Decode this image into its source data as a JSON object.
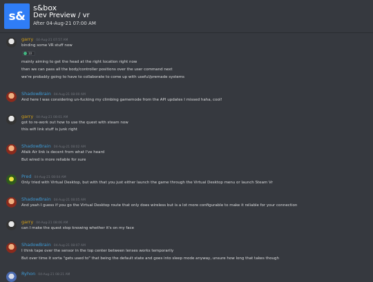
{
  "header": {
    "logo_text": "s&",
    "server_name": "s&box",
    "channel": "Dev Preview / vr",
    "date_filter": "After 04-Aug-21 07:00 AM"
  },
  "colors": {
    "garry": "#d4a017",
    "ShadowBrain": "#3e9bd6",
    "Pred": "#3e9bd6",
    "Ryhon": "#3e9bd6"
  },
  "messages": [
    {
      "author": "garry",
      "timestamp": "04-Aug-21 07:57 AM",
      "avatar": "garry-avatar",
      "lines": [
        "binding some VR stuff now"
      ],
      "reaction": {
        "emoji": "green-emoji-icon",
        "count": "10"
      },
      "extra_lines": [
        "mainly aiming to get the head at the right location right now",
        "then we can pass all the body/controller positions over the user command next",
        "we're probably going to have to collaborate to come up with useful/premade systems"
      ]
    },
    {
      "author": "ShadowBrain",
      "timestamp": "04-Aug-21 08:00 AM",
      "avatar": "shadowbrain-avatar",
      "lines": [
        "And here I was considering un-fucking my climbing gamemode from the API updates I missed haha, cool!"
      ]
    },
    {
      "author": "garry",
      "timestamp": "04-Aug-21 08:01 AM",
      "avatar": "garry-avatar",
      "lines": [
        "got to re-work out how to use the quest with steam now",
        "this wifi link stuff is junk right"
      ]
    },
    {
      "author": "ShadowBrain",
      "timestamp": "04-Aug-21 08:02 AM",
      "avatar": "shadowbrain-avatar",
      "lines": [
        "Afaik Air link is decent from what I've heard",
        "But wired is more reliable for sure"
      ]
    },
    {
      "author": "Pred",
      "timestamp": "04-Aug-21 08:04 AM",
      "avatar": "pred-avatar",
      "lines": [
        "Only tried with Virtual Desktop, but with that you just either launch the game through the Virtual Desktop menu or launch Steam Vr"
      ]
    },
    {
      "author": "ShadowBrain",
      "timestamp": "04-Aug-21 08:05 AM",
      "avatar": "shadowbrain-avatar",
      "lines": [
        "And yeah I guess if you go the Virtual Desktop route that only does wireless but is a lot more configurable to make it reliable for your connection"
      ]
    },
    {
      "author": "garry",
      "timestamp": "04-Aug-21 08:06 AM",
      "avatar": "garry-avatar",
      "lines": [
        "can I make the quest stop knowing whether it's on my face"
      ]
    },
    {
      "author": "ShadowBrain",
      "timestamp": "04-Aug-21 08:07 AM",
      "avatar": "shadowbrain-avatar",
      "lines": [
        "I think tape over the sensor in the top center between lenses works temporarily",
        "But over time it sorta \"gets used to\" that being the default state and goes into sleep mode anyway, unsure how long that takes though"
      ]
    },
    {
      "author": "Ryhon",
      "timestamp": "04-Aug-21 08:21 AM",
      "avatar": "ryhon-avatar",
      "lines": []
    }
  ]
}
